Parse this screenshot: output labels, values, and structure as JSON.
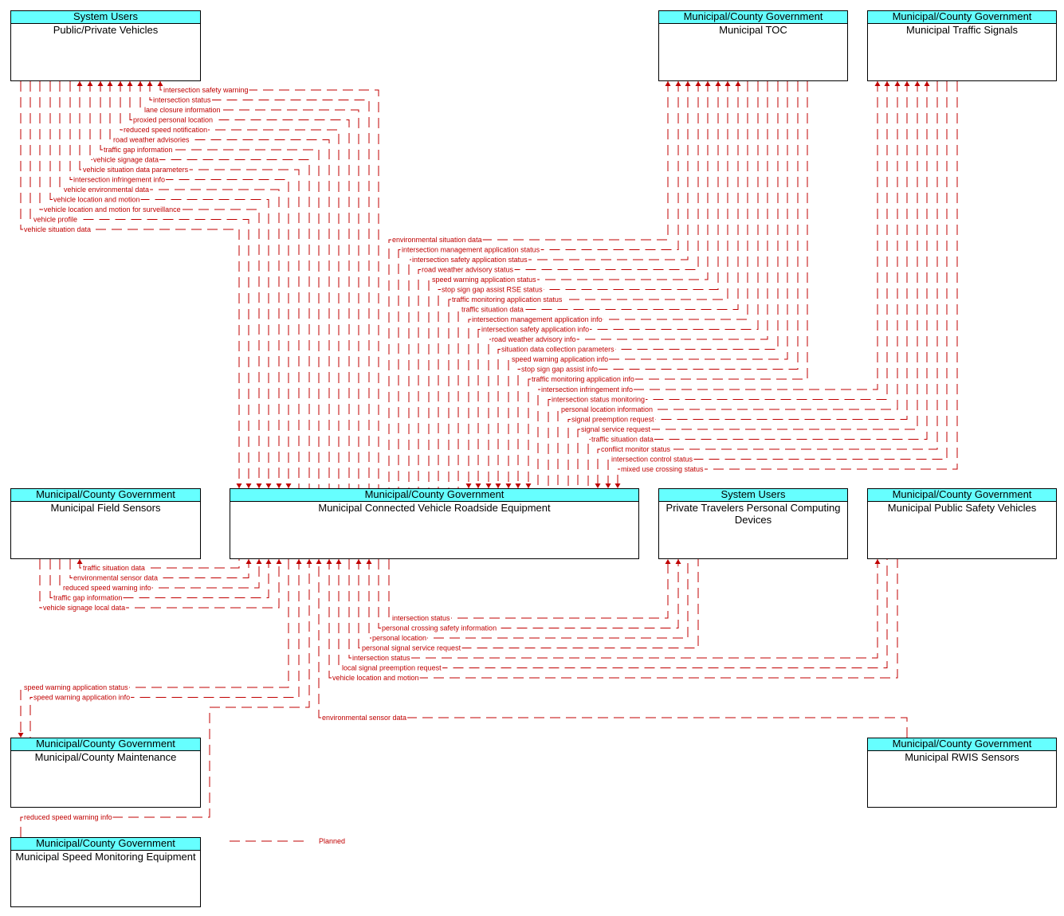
{
  "elements": {
    "pv": {
      "stakeholder": "System Users",
      "name": "Public/Private Vehicles"
    },
    "toc": {
      "stakeholder": "Municipal/County Government",
      "name": "Municipal TOC"
    },
    "ts": {
      "stakeholder": "Municipal/County Government",
      "name": "Municipal Traffic Signals"
    },
    "fs": {
      "stakeholder": "Municipal/County Government",
      "name": "Municipal Field Sensors"
    },
    "rse": {
      "stakeholder": "Municipal/County Government",
      "name": "Municipal Connected Vehicle Roadside Equipment"
    },
    "ptd": {
      "stakeholder": "System Users",
      "name": "Private Travelers Personal Computing Devices"
    },
    "psv": {
      "stakeholder": "Municipal/County Government",
      "name": "Municipal Public Safety Vehicles"
    },
    "mnt": {
      "stakeholder": "Municipal/County Government",
      "name": "Municipal/County Maintenance"
    },
    "rwis": {
      "stakeholder": "Municipal/County Government",
      "name": "Municipal RWIS Sensors"
    },
    "sme": {
      "stakeholder": "Municipal/County Government",
      "name": "Municipal Speed Monitoring Equipment"
    }
  },
  "flows": {
    "pv_rse": [
      {
        "label": "intersection safety warning",
        "to": "pv"
      },
      {
        "label": "intersection status",
        "to": "pv"
      },
      {
        "label": "lane closure information",
        "to": "pv"
      },
      {
        "label": "proxied personal location",
        "to": "pv"
      },
      {
        "label": "reduced speed notification",
        "to": "pv"
      },
      {
        "label": "road weather advisories",
        "to": "pv"
      },
      {
        "label": "traffic gap information",
        "to": "pv"
      },
      {
        "label": "vehicle signage data",
        "to": "pv"
      },
      {
        "label": "vehicle situation data parameters",
        "to": "pv"
      },
      {
        "label": "intersection infringement info",
        "to": "rse"
      },
      {
        "label": "vehicle environmental data",
        "to": "rse"
      },
      {
        "label": "vehicle location and motion",
        "to": "rse"
      },
      {
        "label": "vehicle location and motion for surveillance",
        "to": "rse"
      },
      {
        "label": "vehicle profile",
        "to": "rse"
      },
      {
        "label": "vehicle situation data",
        "to": "rse"
      }
    ],
    "toc_rse": [
      {
        "label": "environmental situation data",
        "to": "toc"
      },
      {
        "label": "intersection management application status",
        "to": "toc"
      },
      {
        "label": "intersection safety application status",
        "to": "toc"
      },
      {
        "label": "road weather advisory status",
        "to": "toc"
      },
      {
        "label": "speed warning application status",
        "to": "toc"
      },
      {
        "label": "stop sign gap assist RSE status",
        "to": "toc"
      },
      {
        "label": "traffic monitoring application status",
        "to": "toc"
      },
      {
        "label": "traffic situation data",
        "to": "toc"
      },
      {
        "label": "intersection management application info",
        "to": "rse"
      },
      {
        "label": "intersection safety application info",
        "to": "rse"
      },
      {
        "label": "road weather advisory info",
        "to": "rse"
      },
      {
        "label": "situation data collection parameters",
        "to": "rse"
      },
      {
        "label": "speed warning application info",
        "to": "rse"
      },
      {
        "label": "stop sign gap assist info",
        "to": "rse"
      },
      {
        "label": "traffic monitoring application info",
        "to": "rse"
      }
    ],
    "ts_rse": [
      {
        "label": "intersection infringement info",
        "to": "ts"
      },
      {
        "label": "intersection status monitoring",
        "to": "ts"
      },
      {
        "label": "personal location information",
        "to": "ts"
      },
      {
        "label": "signal preemption request",
        "to": "ts"
      },
      {
        "label": "signal service request",
        "to": "ts"
      },
      {
        "label": "traffic situation data",
        "to": "ts"
      },
      {
        "label": "conflict monitor status",
        "to": "rse"
      },
      {
        "label": "intersection control status",
        "to": "rse"
      },
      {
        "label": "mixed use crossing status",
        "to": "rse"
      }
    ],
    "fs_rse": [
      {
        "label": "traffic situation data",
        "to": "fs"
      },
      {
        "label": "environmental sensor data",
        "to": "rse"
      },
      {
        "label": "reduced speed warning info",
        "to": "rse"
      },
      {
        "label": "traffic gap information",
        "to": "rse"
      },
      {
        "label": "vehicle signage local data",
        "to": "rse"
      }
    ],
    "ptd_rse": [
      {
        "label": "intersection status",
        "to": "ptd"
      },
      {
        "label": "personal crossing safety information",
        "to": "ptd"
      },
      {
        "label": "personal location",
        "to": "rse"
      },
      {
        "label": "personal signal service request",
        "to": "rse"
      }
    ],
    "psv_rse": [
      {
        "label": "intersection status",
        "to": "psv"
      },
      {
        "label": "local signal preemption request",
        "to": "rse"
      },
      {
        "label": "vehicle location and motion",
        "to": "rse"
      }
    ],
    "mnt_rse": [
      {
        "label": "speed warning application status",
        "to": "mnt"
      },
      {
        "label": "speed warning application info",
        "to": "rse"
      }
    ],
    "sme_rse": [
      {
        "label": "reduced speed warning info",
        "to": "rse"
      }
    ],
    "rwis_rse": [
      {
        "label": "environmental sensor data",
        "to": "rse"
      }
    ]
  },
  "legend": {
    "label": "Planned"
  },
  "colors": {
    "flow": "#c00000",
    "header": "#66ffff",
    "border": "#000000"
  }
}
